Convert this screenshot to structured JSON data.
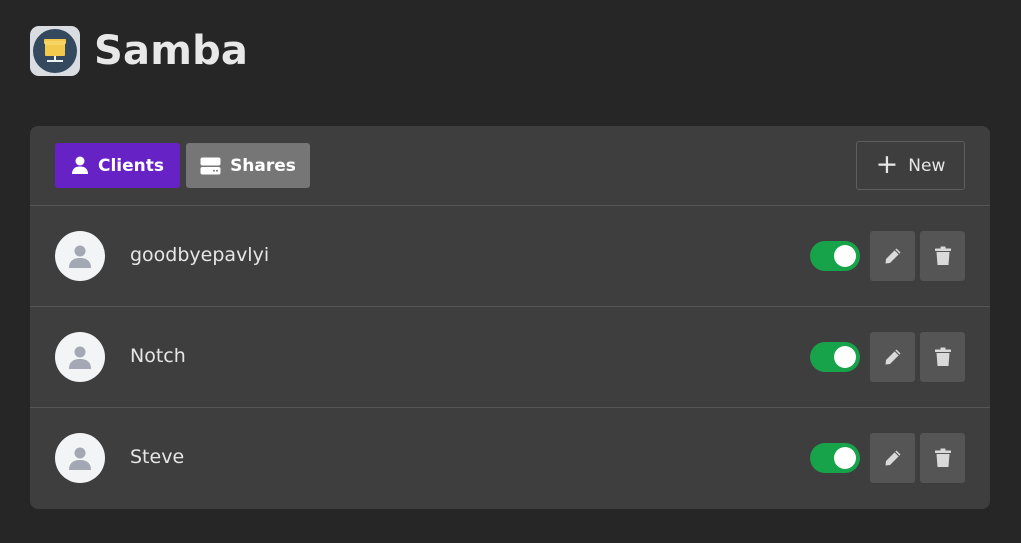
{
  "app": {
    "title": "Samba",
    "icon": "samba-network-folder-icon"
  },
  "tabs": [
    {
      "label": "Clients",
      "icon": "user-icon",
      "active": true,
      "color": "#6722c6"
    },
    {
      "label": "Shares",
      "icon": "drive-icon",
      "active": false,
      "color": "#767676"
    }
  ],
  "toolbar": {
    "new_label": "New",
    "new_icon": "plus-icon"
  },
  "clients": [
    {
      "name": "goodbyepavlyi",
      "enabled": true
    },
    {
      "name": "Notch",
      "enabled": true
    },
    {
      "name": "Steve",
      "enabled": true
    }
  ],
  "colors": {
    "accent": "#6722c6",
    "toggle_on": "#16a34a",
    "background": "#262626",
    "panel": "#3e3e3e"
  }
}
